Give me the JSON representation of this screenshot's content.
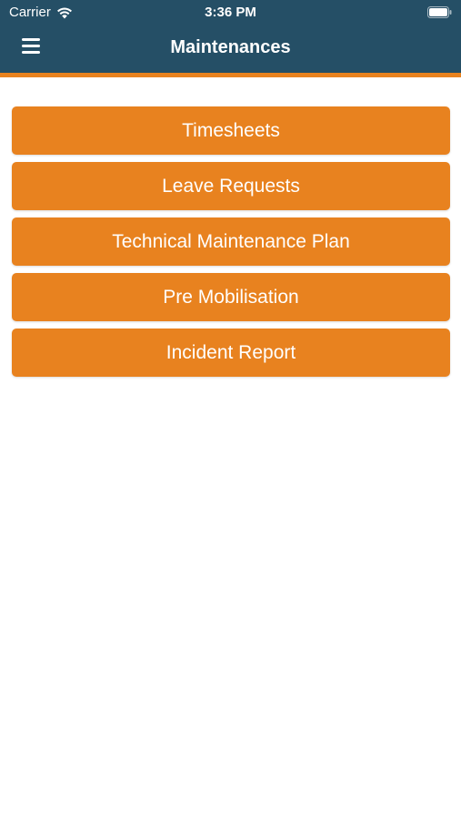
{
  "status_bar": {
    "carrier": "Carrier",
    "time": "3:36 PM",
    "icons": [
      "wifi-icon",
      "battery-icon"
    ]
  },
  "header": {
    "title": "Maintenances",
    "menu_icon": "hamburger-menu-icon",
    "background_color": "#254f66",
    "accent_color": "#e8821f"
  },
  "menu": {
    "items": [
      {
        "label": "Timesheets"
      },
      {
        "label": "Leave Requests"
      },
      {
        "label": "Technical Maintenance Plan"
      },
      {
        "label": "Pre Mobilisation"
      },
      {
        "label": "Incident Report"
      }
    ],
    "button_color": "#e8821f",
    "text_color": "#ffffff"
  }
}
